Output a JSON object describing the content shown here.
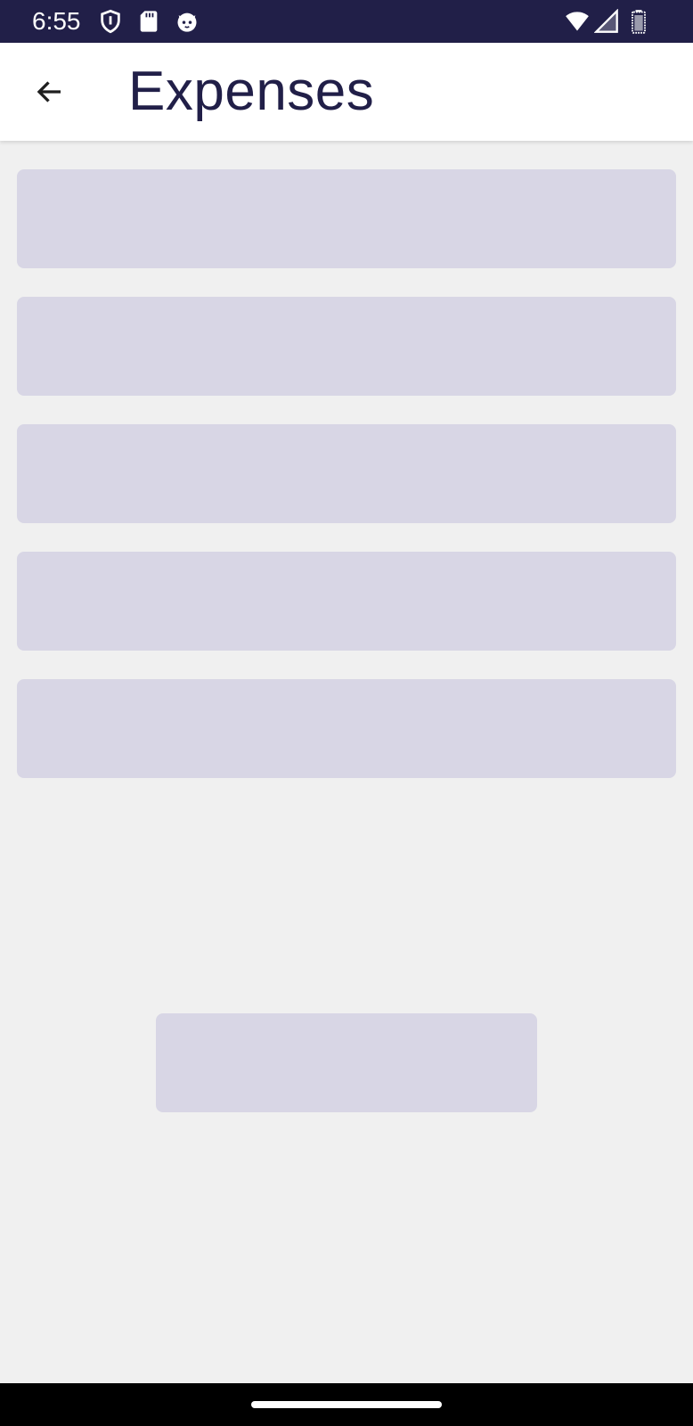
{
  "status_bar": {
    "time": "6:55",
    "left_icons": [
      "shield-icon",
      "sd-card-icon",
      "cat-face-icon"
    ],
    "right_icons": [
      "wifi-icon",
      "signal-icon",
      "battery-icon"
    ],
    "background_color": "#211f48"
  },
  "app_bar": {
    "title": "Expenses",
    "back_icon": "arrow-left-icon",
    "title_color": "#211f48"
  },
  "content": {
    "loading_placeholder_count": 5,
    "placeholder_color": "#d8d6e5",
    "background_color": "#f0f0f0"
  },
  "system_nav": {
    "handle": "home-indicator"
  }
}
